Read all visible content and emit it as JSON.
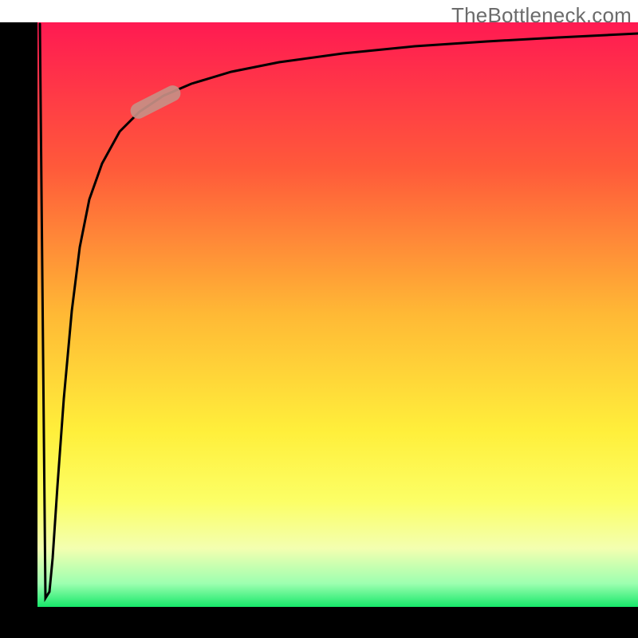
{
  "watermark": {
    "text": "TheBottleneck.com"
  },
  "chart_data": {
    "type": "line",
    "title": "",
    "xlabel": "",
    "ylabel": "",
    "xlim": [
      0,
      100
    ],
    "ylim": [
      0,
      100
    ],
    "grid": false,
    "legend": false,
    "notes": "No axis tick labels or data labels are shown; y-values estimated from pixel position relative to the plot frame.",
    "series": [
      {
        "name": "bottleneck-curve",
        "x": [
          0,
          2,
          3,
          4,
          5,
          6,
          7,
          8,
          9,
          10,
          12,
          14,
          16,
          18,
          20,
          25,
          30,
          40,
          50,
          60,
          70,
          80,
          90,
          100
        ],
        "y": [
          100,
          3,
          8,
          20,
          35,
          50,
          60,
          68,
          74,
          78,
          82,
          85,
          87,
          88.5,
          89.5,
          91.5,
          93,
          94.5,
          95.5,
          96,
          96.5,
          97,
          97.5,
          98
        ]
      }
    ],
    "highlight_segment": {
      "description": "light brown/pink pill marker sitting on the curve",
      "x_range": [
        16,
        24
      ],
      "y_range": [
        87,
        91
      ],
      "color": "#c78f86"
    },
    "background_gradient": {
      "orientation": "vertical",
      "stops": [
        {
          "pos": 0.0,
          "color": "#ff1a52"
        },
        {
          "pos": 0.25,
          "color": "#ff5a3a"
        },
        {
          "pos": 0.5,
          "color": "#ffb935"
        },
        {
          "pos": 0.7,
          "color": "#ffef3b"
        },
        {
          "pos": 0.82,
          "color": "#fcff66"
        },
        {
          "pos": 0.9,
          "color": "#f3ffb0"
        },
        {
          "pos": 0.96,
          "color": "#9dffb0"
        },
        {
          "pos": 1.0,
          "color": "#17e86a"
        }
      ]
    },
    "frame_color": "#000000"
  }
}
